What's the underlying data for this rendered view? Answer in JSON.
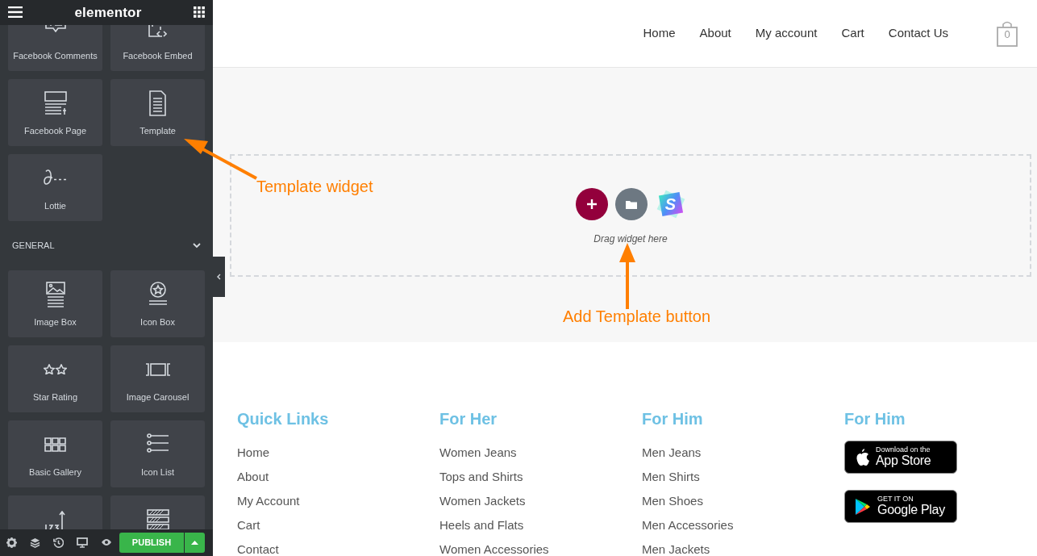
{
  "sidebar": {
    "logo": "elementor",
    "widgets_top": [
      {
        "label": "Facebook Comments"
      },
      {
        "label": "Facebook Embed"
      },
      {
        "label": "Facebook Page"
      },
      {
        "label": "Template"
      },
      {
        "label": "Lottie"
      }
    ],
    "section": {
      "title": "GENERAL",
      "expanded": true
    },
    "widgets": [
      {
        "label": "Image Box",
        "cut": false
      },
      {
        "label": "Icon Box",
        "cut": false
      },
      {
        "label": "Star Rating",
        "cut": false
      },
      {
        "label": "Image Carousel",
        "cut": false
      },
      {
        "label": "Basic Gallery",
        "cut": false
      },
      {
        "label": "Icon List",
        "cut": false
      },
      {
        "cut": true
      },
      {
        "cut": true
      }
    ],
    "publish": "PUBLISH"
  },
  "header": {
    "nav": [
      "Home",
      "About",
      "My account",
      "Cart",
      "Contact Us"
    ],
    "cart_count": "0"
  },
  "drop_area": {
    "hint": "Drag widget here",
    "logo_letter": "S"
  },
  "annotations": [
    {
      "text": "Template widget"
    },
    {
      "text": "Add Template button"
    }
  ],
  "footer": {
    "columns": [
      {
        "heading": "Quick Links",
        "links": [
          "Home",
          "About",
          "My Account",
          "Cart",
          "Contact"
        ]
      },
      {
        "heading": "For Her",
        "links": [
          "Women Jeans",
          "Tops and Shirts",
          "Women Jackets",
          "Heels and Flats",
          "Women Accessories"
        ]
      },
      {
        "heading": "For Him",
        "links": [
          "Men Jeans",
          "Men Shirts",
          "Men Shoes",
          "Men Accessories",
          "Men Jackets"
        ]
      },
      {
        "heading": "For Him",
        "badges": [
          {
            "kind": "apple",
            "small": "Download on the",
            "big": "App Store"
          },
          {
            "kind": "google",
            "small": "GET IT ON",
            "big": "Google Play"
          }
        ]
      }
    ]
  }
}
